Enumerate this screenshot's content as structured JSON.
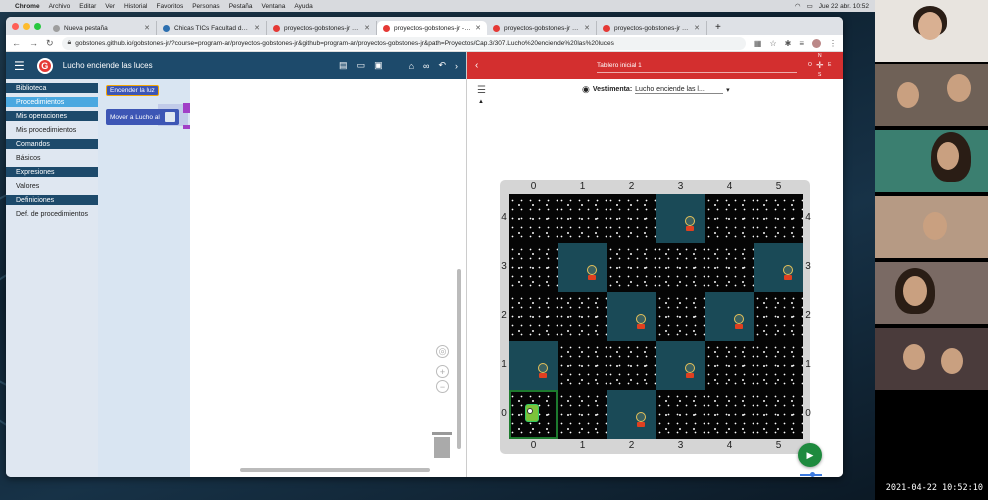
{
  "menubar": {
    "app": "Chrome",
    "items": [
      "Archivo",
      "Editar",
      "Ver",
      "Historial",
      "Favoritos",
      "Personas",
      "Pestaña",
      "Ventana",
      "Ayuda"
    ],
    "clock": "Jue 22 abr. 10:52"
  },
  "browser": {
    "tabs": [
      {
        "title": "Nueva pestaña",
        "color": "#9e9e9e"
      },
      {
        "title": "Chicas TICs Facultad de Ingeni",
        "color": "#2c6fb0"
      },
      {
        "title": "proyectos-gobstones-jr - Gob",
        "color": "#e53935"
      },
      {
        "title": "proyectos-gobstones-jr - Gob",
        "color": "#e53935"
      },
      {
        "title": "proyectos-gobstones-jr - Gob",
        "color": "#e53935"
      },
      {
        "title": "proyectos-gobstones-jr - Gob",
        "color": "#e53935"
      }
    ],
    "active_tab": 3,
    "url": "gobstones.github.io/gobstones-jr/?course=program-ar/proyectos-gobstones-jr&github=program-ar/proyectos-gobstones-jr&path=Proyectos/Cap.3/307.Lucho%20enciende%20las%20luces"
  },
  "editor": {
    "title": "Lucho enciende las luces",
    "toolbox": [
      {
        "label": "Biblioteca",
        "kind": "cat"
      },
      {
        "label": "Procedimientos",
        "kind": "sel"
      },
      {
        "label": "Mis operaciones",
        "kind": "cat"
      },
      {
        "label": "Mis procedimientos",
        "kind": "plain"
      },
      {
        "label": "Comandos",
        "kind": "cat"
      },
      {
        "label": "Básicos",
        "kind": "plain"
      },
      {
        "label": "Expresiones",
        "kind": "cat"
      },
      {
        "label": "Valores",
        "kind": "plain"
      },
      {
        "label": "Definiciones",
        "kind": "cat"
      },
      {
        "label": "Def. de procedimientos",
        "kind": "plain"
      }
    ],
    "blocks": {
      "block1": "Encender la luz",
      "block2": "Mover a Lucho al"
    }
  },
  "board_panel": {
    "title": "Tablero inicial 1",
    "compass": {
      "n": "N",
      "s": "S",
      "e": "E",
      "w": "O"
    },
    "vestimenta_label": "Vestimenta:",
    "vestimenta_value": "Lucho enciende las l...",
    "columns": [
      "0",
      "1",
      "2",
      "3",
      "4",
      "5"
    ],
    "rows": [
      "4",
      "3",
      "2",
      "1",
      "0"
    ],
    "cells": [
      [
        0,
        0,
        0,
        1,
        0,
        0
      ],
      [
        0,
        1,
        0,
        0,
        0,
        1
      ],
      [
        0,
        0,
        1,
        0,
        1,
        0
      ],
      [
        1,
        0,
        0,
        1,
        0,
        0
      ],
      [
        0,
        0,
        1,
        0,
        0,
        0
      ]
    ],
    "lucho_position": {
      "column": 0,
      "row": 0
    }
  },
  "video_call": {
    "timestamp": "2021-04-22  10:52:10"
  }
}
